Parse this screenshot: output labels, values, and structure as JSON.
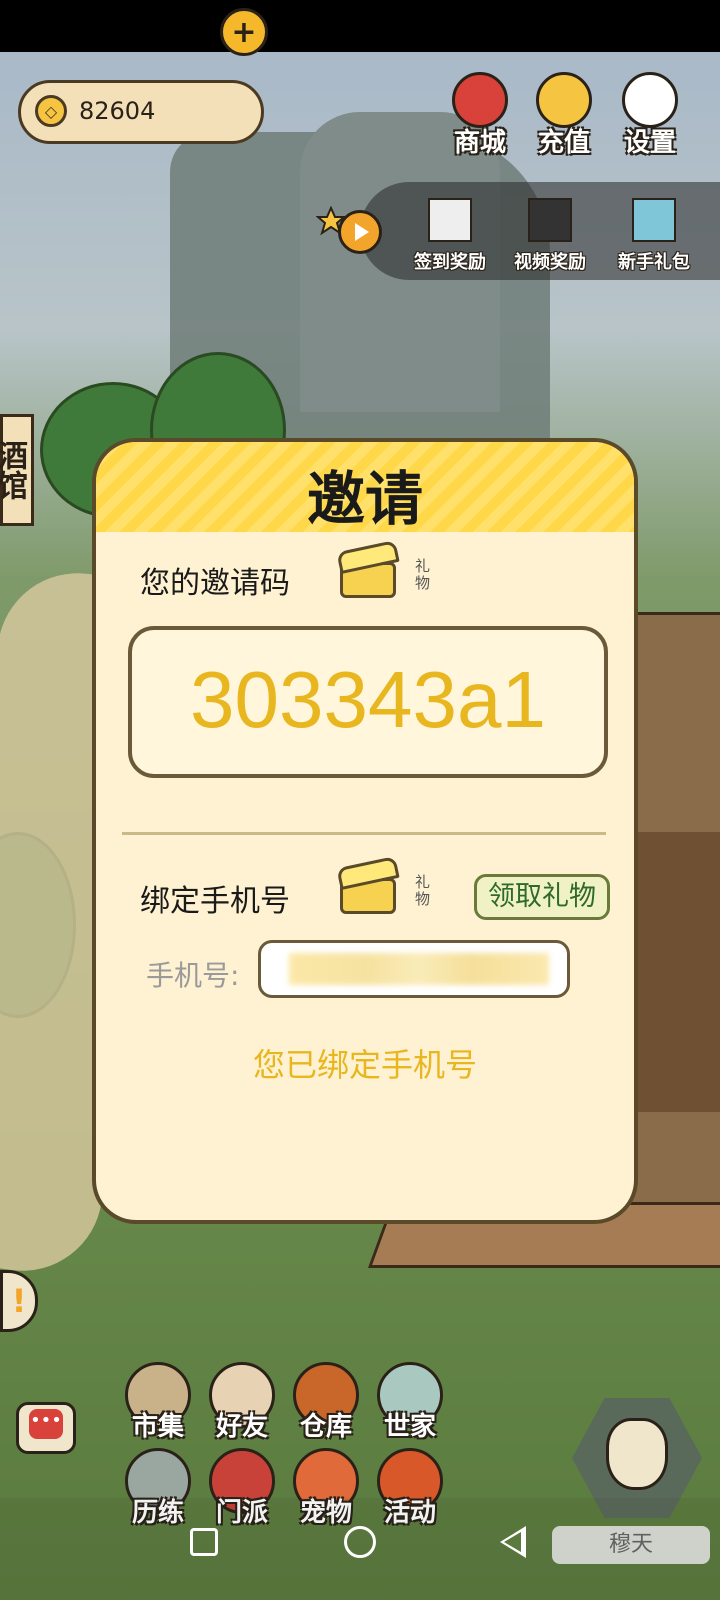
{
  "currency": {
    "icon": "coin-icon",
    "value": "82604",
    "plus_label": "+"
  },
  "top_menu": [
    {
      "label": "商城",
      "icon": "shop-bag-icon",
      "color": "#d9423a"
    },
    {
      "label": "充值",
      "icon": "gold-ingot-icon",
      "color": "#f5c542"
    },
    {
      "label": "设置",
      "icon": "gear-icon",
      "color": "#ffffff"
    }
  ],
  "rewards": [
    {
      "label": "签到奖励",
      "icon": "calendar-icon"
    },
    {
      "label": "视频奖励",
      "icon": "clapperboard-icon"
    },
    {
      "label": "新手礼包",
      "icon": "treasure-chest-icon"
    }
  ],
  "side_sign": "酒馆",
  "modal": {
    "title": "邀请",
    "invite_code_label": "您的邀请码",
    "gift_label": "礼物",
    "invite_code": "303343a1",
    "bind_phone_label": "绑定手机号",
    "claim_button": "领取礼物",
    "phone_label": "手机号:",
    "bound_status": "您已绑定手机号"
  },
  "bottom_menu": [
    {
      "label": "市集",
      "icon": "market-stall-icon"
    },
    {
      "label": "好友",
      "icon": "handshake-icon"
    },
    {
      "label": "仓库",
      "icon": "storage-chest-icon"
    },
    {
      "label": "世家",
      "icon": "clan-house-icon"
    },
    {
      "label": "历练",
      "icon": "crossed-swords-icon"
    },
    {
      "label": "门派",
      "icon": "sect-banner-icon"
    },
    {
      "label": "宠物",
      "icon": "paw-icon"
    },
    {
      "label": "活动",
      "icon": "lantern-icon"
    }
  ],
  "chat_channel": "穆天",
  "colors": {
    "accent": "#e8b61e",
    "modal_bg": "#fff2d2",
    "header_yellow": "#ffd84a",
    "claim_green": "#2f6a2a"
  }
}
